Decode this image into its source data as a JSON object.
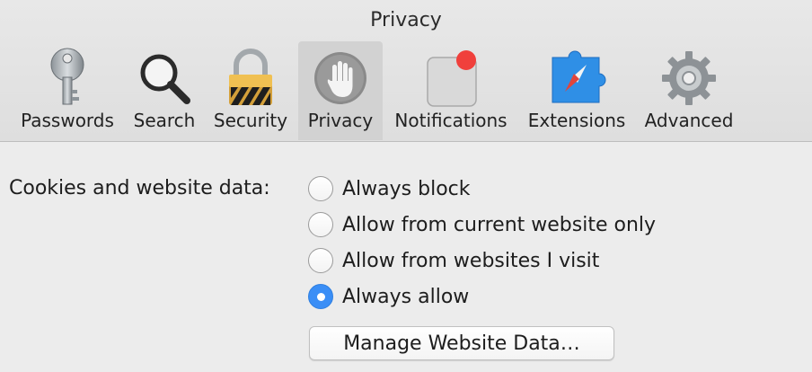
{
  "window": {
    "title": "Privacy"
  },
  "tabs": [
    {
      "id": "passwords",
      "label": "Passwords",
      "icon": "key-icon"
    },
    {
      "id": "search",
      "label": "Search",
      "icon": "magnifier-icon"
    },
    {
      "id": "security",
      "label": "Security",
      "icon": "padlock-icon"
    },
    {
      "id": "privacy",
      "label": "Privacy",
      "icon": "hand-icon",
      "selected": true
    },
    {
      "id": "notifications",
      "label": "Notifications",
      "icon": "notification-badge-icon"
    },
    {
      "id": "extensions",
      "label": "Extensions",
      "icon": "puzzle-compass-icon"
    },
    {
      "id": "advanced",
      "label": "Advanced",
      "icon": "gear-icon"
    }
  ],
  "cookies": {
    "label": "Cookies and website data:",
    "options": [
      {
        "label": "Always block",
        "selected": false
      },
      {
        "label": "Allow from current website only",
        "selected": false
      },
      {
        "label": "Allow from websites I visit",
        "selected": false
      },
      {
        "label": "Always allow",
        "selected": true
      }
    ],
    "manage_button": "Manage Website Data…"
  },
  "colors": {
    "accent": "#3a8ef6",
    "notification_badge": "#f0403c",
    "background": "#ececec"
  }
}
